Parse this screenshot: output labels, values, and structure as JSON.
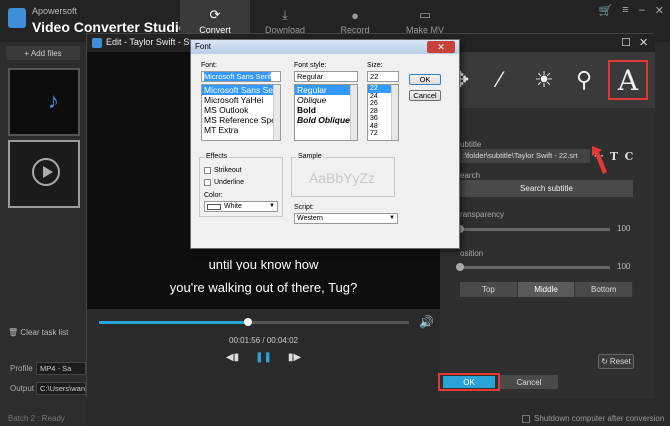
{
  "app": {
    "brand": "Apowersoft",
    "title": "Video Converter Studio",
    "tabs": [
      {
        "label": "Convert",
        "icon": "refresh-icon"
      },
      {
        "label": "Download",
        "icon": "download-icon"
      },
      {
        "label": "Record",
        "icon": "record-icon"
      },
      {
        "label": "Make MV",
        "icon": "tv-icon"
      }
    ],
    "add_files": "+ Add files",
    "clear_task": "Clear task list",
    "profile_label": "Profile",
    "profile_value": "MP4 - Sa",
    "output_label": "Output",
    "output_value": "C:\\Users\\wan",
    "batch": "Batch 2 : Ready",
    "shutdown": "Shutdown computer after conversion"
  },
  "edit": {
    "title": "Edit - Taylor Swift - Style",
    "subtitle_line1": "until you know how",
    "subtitle_line2": "you're walking out of there, Tug?",
    "timecode": "00:01:56 / 00:04:02",
    "progress": 0.48,
    "tools": [
      "move-icon",
      "magic-wand-icon",
      "brightness-icon",
      "stamp-icon",
      "text-icon"
    ],
    "text_tool_glyph": "A",
    "subtitle_label": "ubtitle",
    "subtitle_path": ":\\folder\\subtitle\\Taylor Swift - 22.srt",
    "subtitle_icons": {
      "more": "···",
      "text": "T",
      "copyright": "C"
    },
    "search_label": "earch",
    "search_button": "Search subtitle",
    "transparency_label": "ransparency",
    "transparency_value": "100",
    "position_label": "osition",
    "position_value": "100",
    "positions": [
      "Top",
      "Middle",
      "Bottom"
    ],
    "position_selected": "Middle",
    "reset": "Reset",
    "ok": "OK",
    "cancel": "Cancel"
  },
  "font_dialog": {
    "title": "Font",
    "font_label": "Font:",
    "font_value": "Microsoft Sans Serif",
    "fonts": [
      "Microsoft Sans Serif",
      "Microsoft YaHei",
      "MS Outlook",
      "MS Reference Speci",
      "MT Extra"
    ],
    "style_label": "Font style:",
    "style_value": "Regular",
    "styles": [
      "Regular",
      "Oblique",
      "Bold",
      "Bold Oblique"
    ],
    "size_label": "Size:",
    "size_value": "22",
    "sizes": [
      "22",
      "24",
      "26",
      "28",
      "36",
      "48",
      "72"
    ],
    "ok": "OK",
    "cancel": "Cancel",
    "effects_label": "Effects",
    "strikeout": "Strikeout",
    "underline": "Underline",
    "color_label": "Color:",
    "color_value": "White",
    "sample_label": "Sample",
    "sample_text": "AaBbYyZz",
    "script_label": "Script:",
    "script_value": "Western"
  },
  "colors": {
    "accent": "#2aa3d8",
    "highlight": "#e53935"
  }
}
